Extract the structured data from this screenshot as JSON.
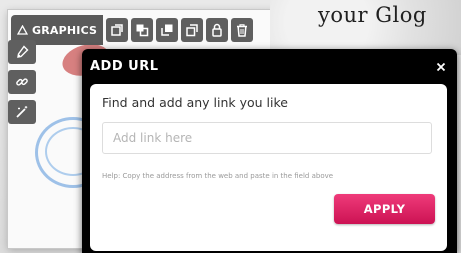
{
  "background": {
    "title_text": "your Glog"
  },
  "toolbar": {
    "graphics_label": "GRAPHICS",
    "icons": [
      "triangle-icon",
      "copy-icon",
      "duplicate-icon",
      "bring-front-icon",
      "send-back-icon",
      "lock-icon",
      "trash-icon"
    ]
  },
  "left_tools": {
    "icons": [
      "brush-icon",
      "link-icon",
      "magic-wand-icon"
    ]
  },
  "modal": {
    "title": "ADD URL",
    "close_symbol": "×",
    "heading": "Find and add any link you like",
    "input": {
      "value": "",
      "placeholder": "Add link here"
    },
    "help": "Help: Copy the address from the web and paste in the field above",
    "apply_label": "APPLY"
  },
  "colors": {
    "modal_frame": "#000000",
    "apply_button": "#e12a6a",
    "toolbar_bg": "#5a5a5a",
    "help_text": "#9a9a9a"
  }
}
